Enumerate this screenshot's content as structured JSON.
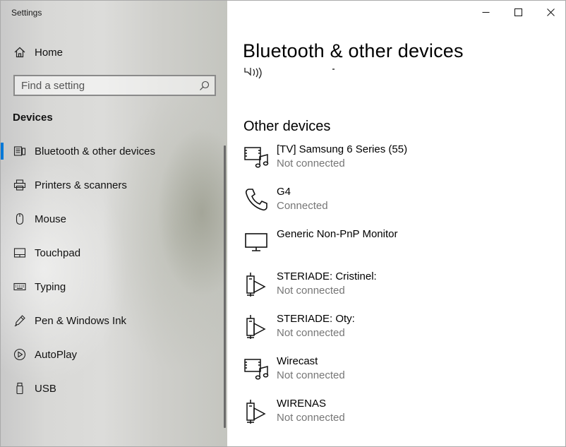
{
  "window": {
    "app_title": "Settings",
    "controls": {
      "minimize": "minimize-icon",
      "maximize": "maximize-icon",
      "close": "close-icon"
    }
  },
  "sidebar": {
    "home_label": "Home",
    "search": {
      "placeholder": "Find a setting",
      "value": ""
    },
    "section_title": "Devices",
    "items": [
      {
        "label": "Bluetooth & other devices",
        "icon": "bluetooth-devices-icon",
        "selected": true
      },
      {
        "label": "Printers & scanners",
        "icon": "printer-icon",
        "selected": false
      },
      {
        "label": "Mouse",
        "icon": "mouse-icon",
        "selected": false
      },
      {
        "label": "Touchpad",
        "icon": "touchpad-icon",
        "selected": false
      },
      {
        "label": "Typing",
        "icon": "keyboard-icon",
        "selected": false
      },
      {
        "label": "Pen & Windows Ink",
        "icon": "pen-icon",
        "selected": false
      },
      {
        "label": "AutoPlay",
        "icon": "autoplay-icon",
        "selected": false
      },
      {
        "label": "USB",
        "icon": "usb-icon",
        "selected": false
      }
    ]
  },
  "main": {
    "title": "Bluetooth & other devices",
    "other_devices_title": "Other devices",
    "devices": [
      {
        "name": "[TV] Samsung 6 Series (55)",
        "status": "Not connected",
        "icon": "media-device-icon"
      },
      {
        "name": "G4",
        "status": "Connected",
        "icon": "phone-icon"
      },
      {
        "name": "Generic Non-PnP Monitor",
        "status": "",
        "icon": "monitor-icon"
      },
      {
        "name": "STERIADE: Cristinel:",
        "status": "Not connected",
        "icon": "media-server-icon"
      },
      {
        "name": "STERIADE: Oty:",
        "status": "Not connected",
        "icon": "media-server-icon"
      },
      {
        "name": "Wirecast",
        "status": "Not connected",
        "icon": "media-device-icon"
      },
      {
        "name": "WIRENAS",
        "status": "Not connected",
        "icon": "media-server-icon"
      }
    ]
  },
  "colors": {
    "accent": "#0078d7",
    "status_text": "#767676"
  }
}
